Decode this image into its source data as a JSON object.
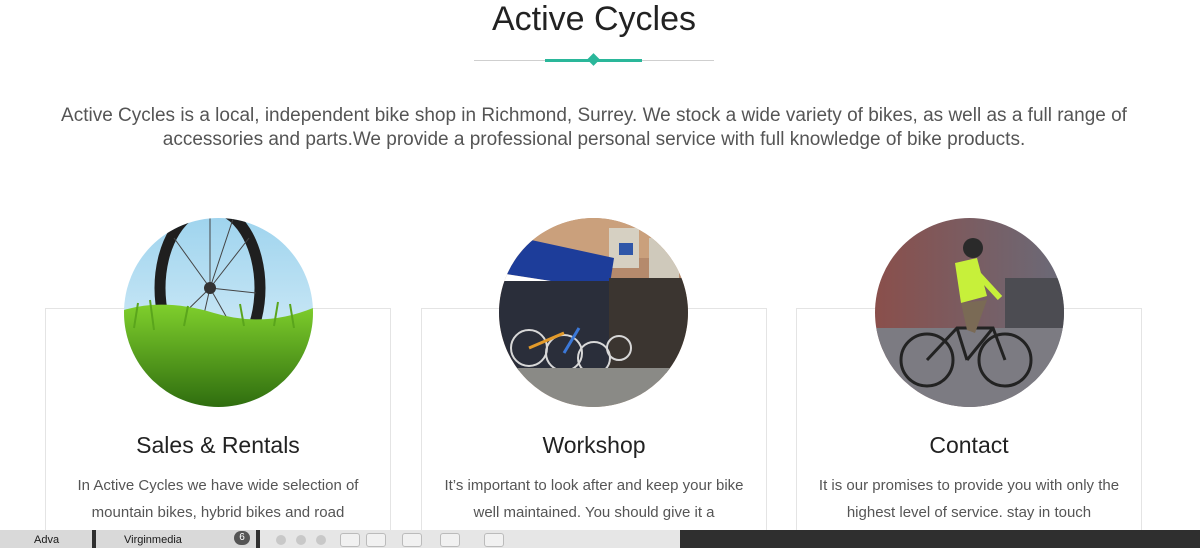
{
  "header": {
    "title": "Active Cycles",
    "accent_color": "#2ab79a"
  },
  "intro": {
    "text": "Active Cycles is a local, independent bike shop in Richmond, Surrey. We stock a wide variety of bikes, as well as a full range of accessories and parts.We provide a professional personal service with full knowledge of bike products."
  },
  "cards": [
    {
      "title": "Sales & Rentals",
      "text": "In Active Cycles we have wide selection of mountain bikes, hybrid bikes and road",
      "image": "bike-wheel-in-grass"
    },
    {
      "title": "Workshop",
      "text": "It’s important to look after and keep your bike well maintained. You should give it a",
      "image": "shop-front-with-bikes"
    },
    {
      "title": "Contact",
      "text": "It is our promises to provide you with only the highest level of service. stay in touch",
      "image": "cyclist-riding"
    }
  ],
  "taskbar": {
    "item1": "Adva",
    "item2": "Virginmedia",
    "badge": "6"
  }
}
